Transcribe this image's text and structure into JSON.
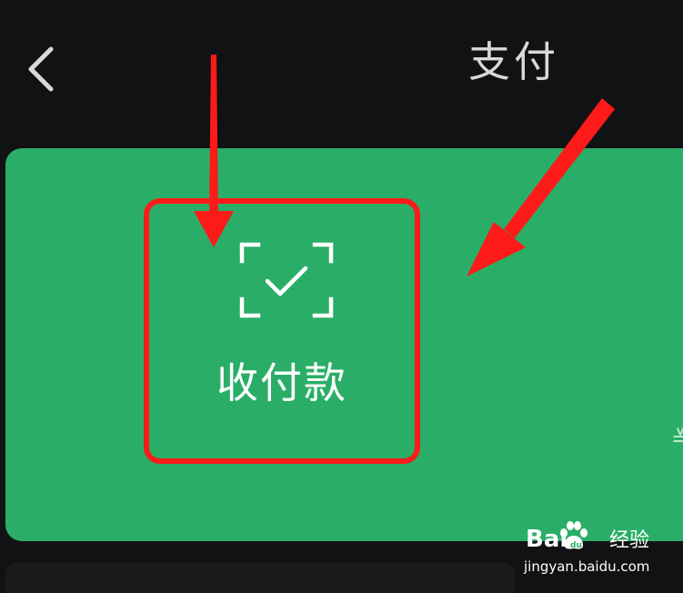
{
  "header": {
    "title": "支付",
    "back_icon": "chevron-left-icon"
  },
  "card": {
    "color": "#2aae67",
    "pay_tile": {
      "label": "收付款",
      "icon": "scan-check-icon"
    },
    "edge_glyph": "≚"
  },
  "annotation": {
    "color": "#ff1a1a"
  },
  "watermark": {
    "brand": "Bai",
    "brand_icon": "baidu-paw-icon",
    "brand_cn": "经验",
    "url": "jingyan.baidu.com"
  }
}
